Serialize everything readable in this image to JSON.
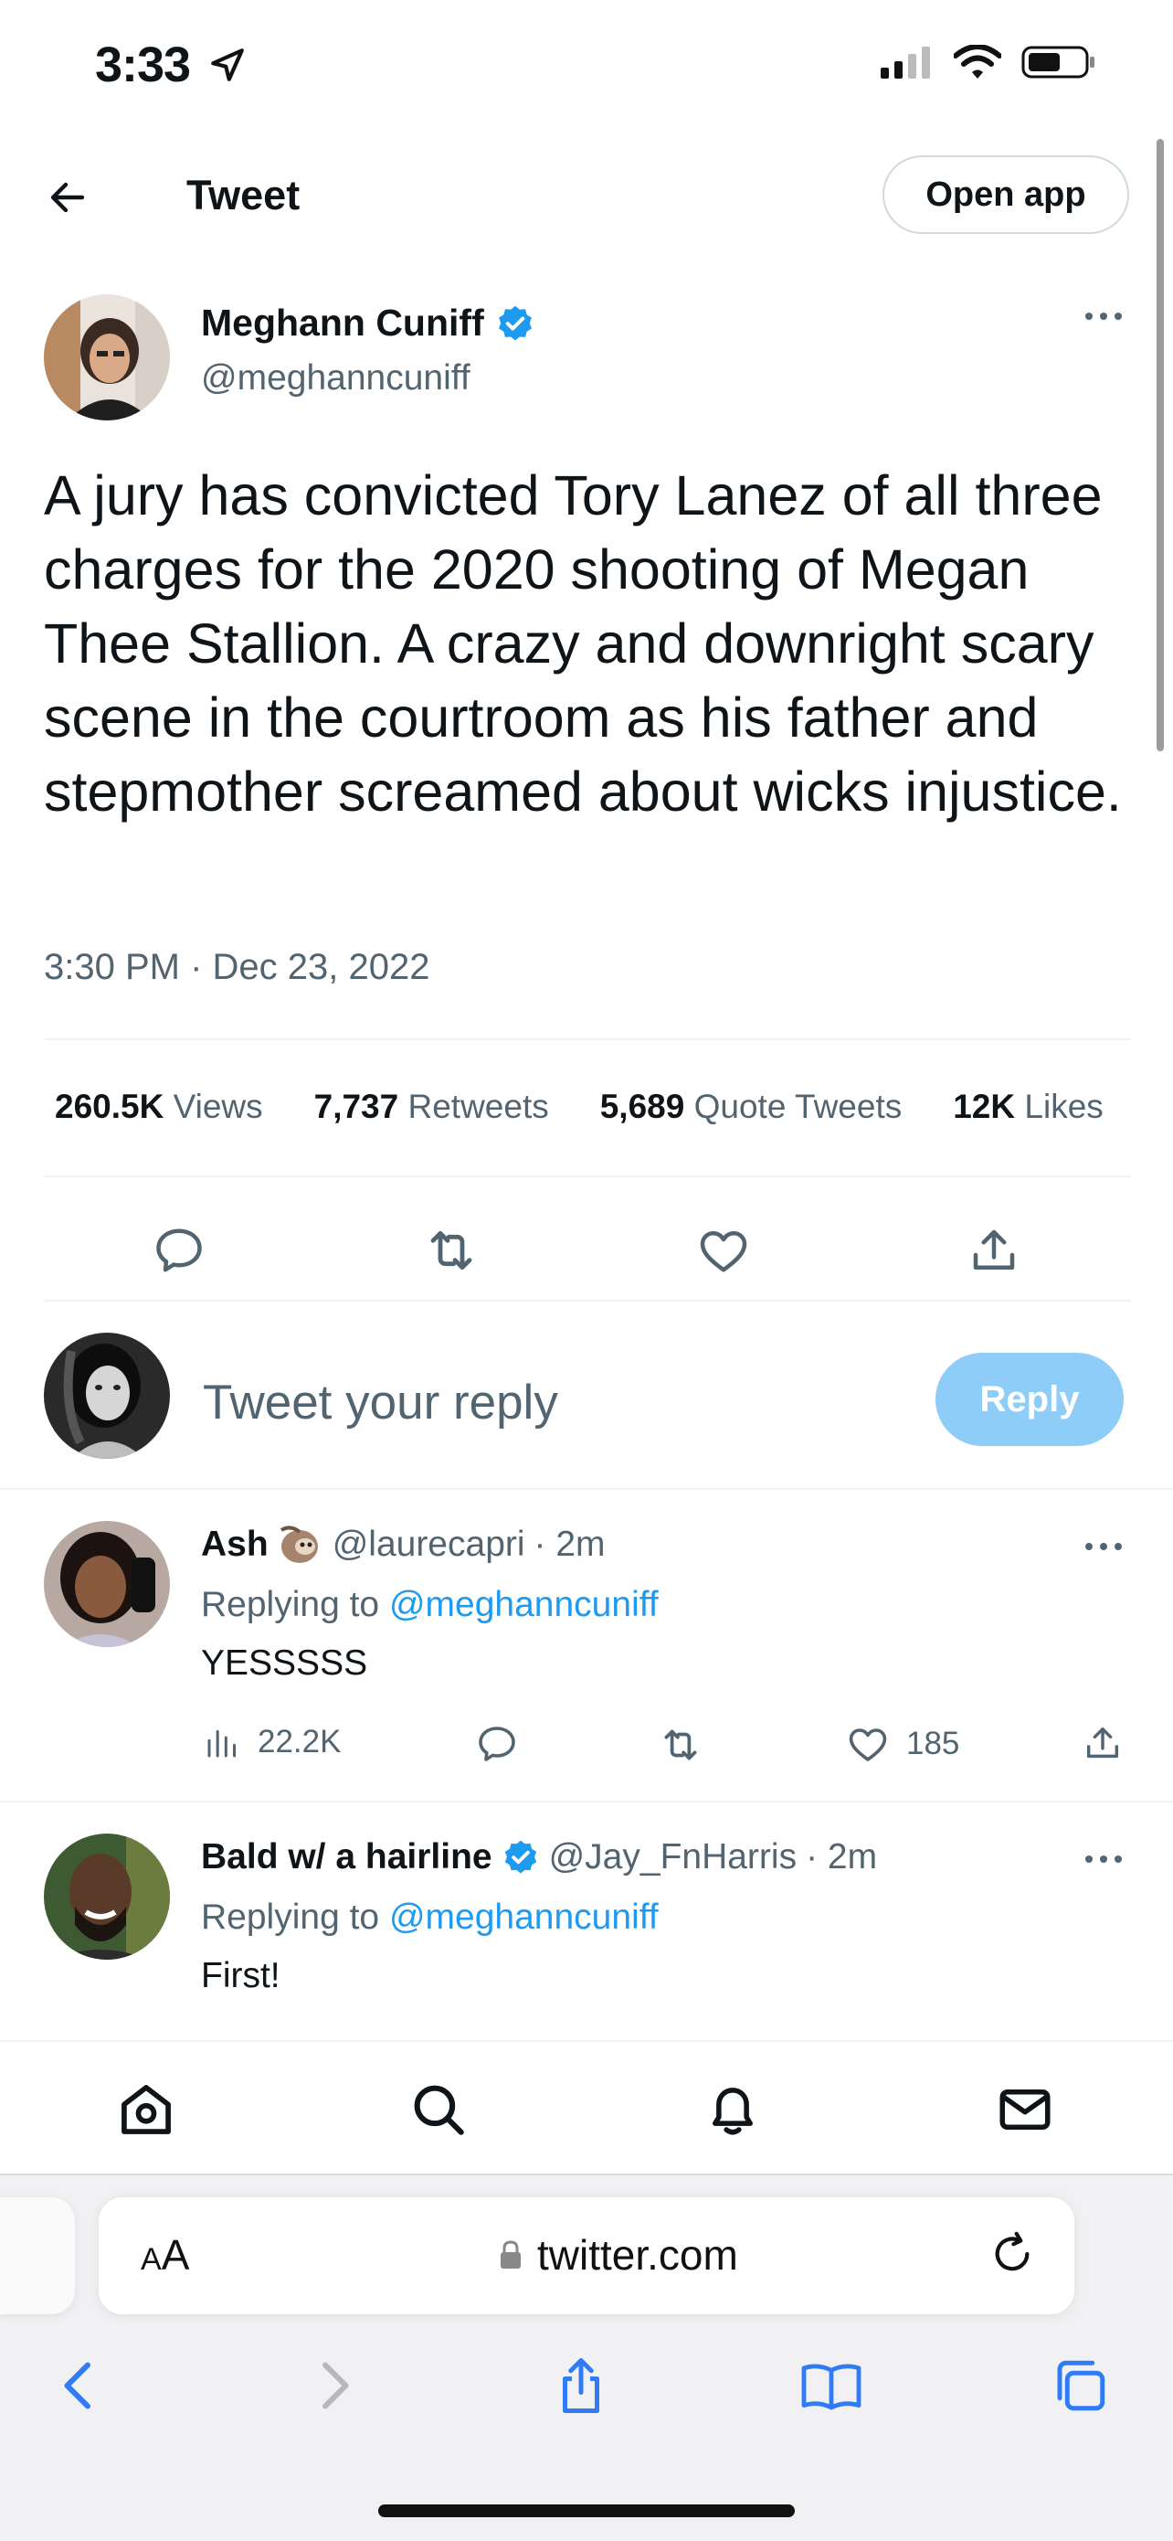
{
  "status_bar": {
    "time": "3:33"
  },
  "header": {
    "title": "Tweet",
    "open_app_label": "Open app"
  },
  "tweet": {
    "author_name": "Meghann Cuniff",
    "author_handle": "@meghanncuniff",
    "text": "A jury has convicted Tory Lanez of all three charges for the 2020 shooting of Megan Thee Stallion. A crazy and downright scary scene in the courtroom as his father and stepmother screamed about wicks injustice.",
    "timestamp": "3:30 PM · Dec 23, 2022",
    "more_label": "···"
  },
  "stats": [
    {
      "value": "260.5K",
      "label": "Views"
    },
    {
      "value": "7,737",
      "label": "Retweets"
    },
    {
      "value": "5,689",
      "label": "Quote Tweets"
    },
    {
      "value": "12K",
      "label": "Likes"
    }
  ],
  "compose": {
    "placeholder": "Tweet your reply",
    "reply_label": "Reply"
  },
  "replies": [
    {
      "name": "Ash",
      "handle": "@laurecapri",
      "time": "· 2m",
      "replying_prefix": "Replying to",
      "replying_to": "@meghanncuniff",
      "text": "YESSSSS",
      "views": "22.2K",
      "likes": "185"
    },
    {
      "name": "Bald w/ a hairline",
      "handle": "@Jay_FnHarris",
      "time": "· 2m",
      "replying_prefix": "Replying to",
      "replying_to": "@meghanncuniff",
      "text": "First!"
    }
  ],
  "bottom_nav": [
    "home-icon",
    "search-icon",
    "bell-icon",
    "mail-icon"
  ],
  "browser": {
    "aa_big": "A",
    "aa_small": "A",
    "url": "twitter.com"
  },
  "colors": {
    "accent": "#1d9bf0",
    "reply_button": "#8ecdf8",
    "secondary_text": "#536471",
    "verified": "#1d9bf0"
  }
}
